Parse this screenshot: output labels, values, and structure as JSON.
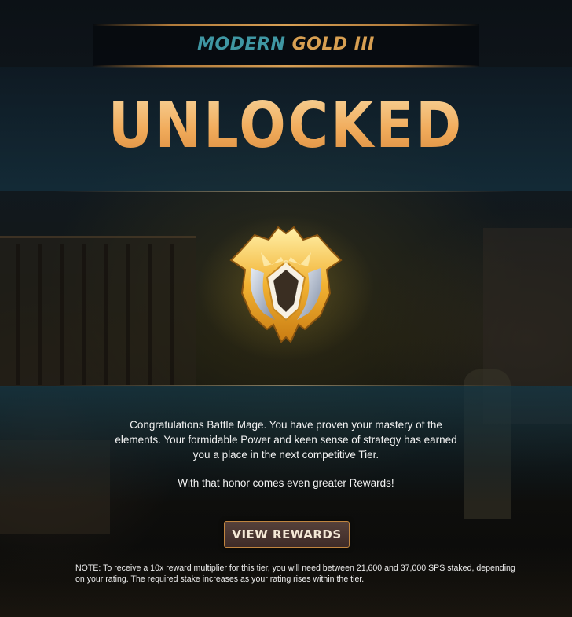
{
  "tier": {
    "prefix": "MODERN",
    "name": "GOLD III"
  },
  "headline": "UNLOCKED",
  "badge": {
    "icon": "gold-league-shield-icon",
    "colors": {
      "gold": "#f2b232",
      "silver": "#a9b4c6",
      "gem": "#3a2e22"
    }
  },
  "message": {
    "congrats": "Congratulations Battle Mage. You have proven your mastery of the elements. Your formidable Power and keen sense of strategy has earned you a place in the next competitive Tier.",
    "honor": "With that honor comes even greater Rewards!"
  },
  "cta": {
    "label": "VIEW REWARDS"
  },
  "note": "NOTE: To receive a 10x reward multiplier for this tier, you will need between 21,600 and 37,000 SPS staked, depending on your rating. The required stake increases as your rating rises within the tier.",
  "colors": {
    "accent_teal": "#3f97a3",
    "accent_gold": "#d8a052",
    "headline": "#f1b36c",
    "button_border": "#c0853f"
  }
}
